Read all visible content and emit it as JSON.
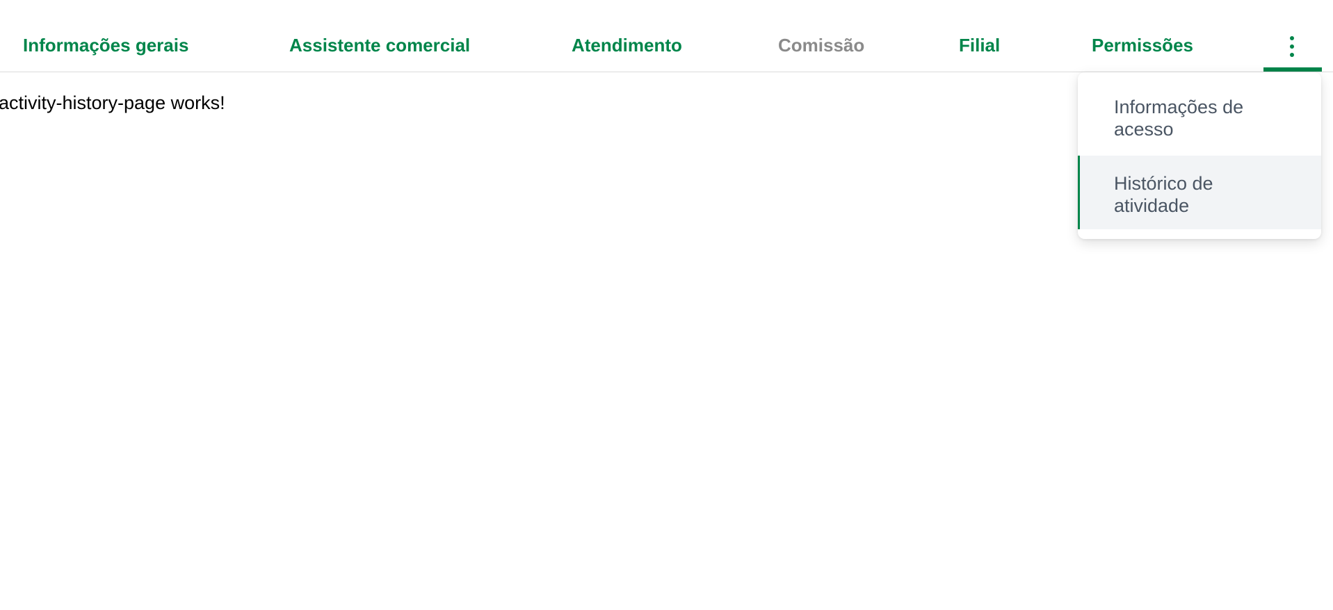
{
  "tabs": {
    "general_info": "Informações gerais",
    "commercial_assistant": "Assistente comercial",
    "service": "Atendimento",
    "commission": "Comissão",
    "branch": "Filial",
    "permissions": "Permissões",
    "more_icon": "more-vertical-icon"
  },
  "content": {
    "text": "activity-history-page works!"
  },
  "menu": {
    "items": [
      {
        "label": "Informações de acesso"
      },
      {
        "label": "Histórico de atividade",
        "selected": true
      }
    ]
  },
  "colors": {
    "accent": "#00854a",
    "disabled_tab": "#8a8a8a",
    "menu_text": "#4a5563",
    "selected_item_bg": "#f2f4f6"
  }
}
